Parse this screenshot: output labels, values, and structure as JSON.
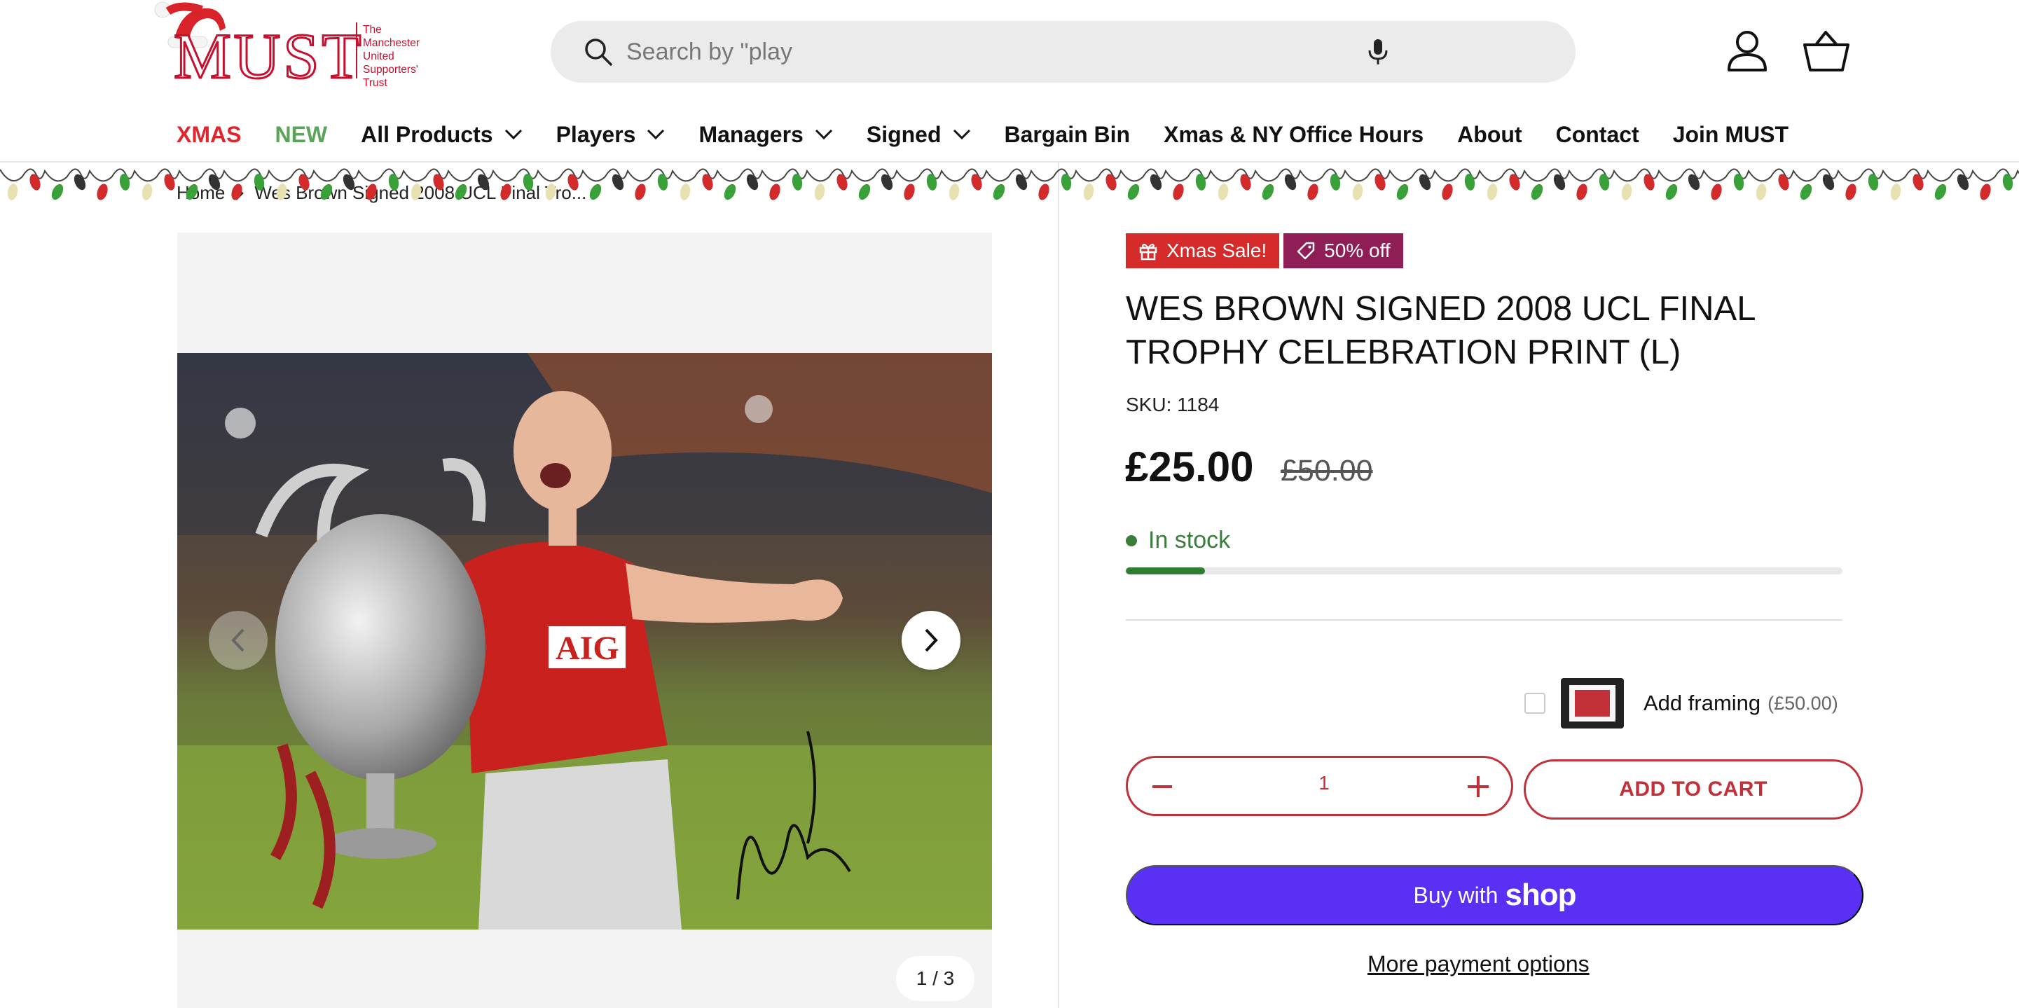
{
  "header": {
    "logo": {
      "text": "MUST",
      "tagline": [
        "The",
        "Manchester",
        "United",
        "Supporters'",
        "Trust"
      ]
    },
    "search": {
      "placeholder": "Search by \"play"
    },
    "icons": [
      "search-icon",
      "microphone-icon",
      "account-icon",
      "cart-icon",
      "santa-hat-icon"
    ]
  },
  "nav": {
    "xmas": "XMAS",
    "new": "NEW",
    "all_products": "All Products",
    "players": "Players",
    "managers": "Managers",
    "signed": "Signed",
    "bargain_bin": "Bargain Bin",
    "office_hours": "Xmas & NY Office Hours",
    "about": "About",
    "contact": "Contact",
    "join": "Join MUST"
  },
  "breadcrumb": {
    "home": "Home",
    "current": "Wes Brown Signed 2008 UCL Final Tro..."
  },
  "gallery": {
    "counter": "1 / 3"
  },
  "product": {
    "badges": {
      "sale": "Xmas Sale!",
      "discount": "50% off"
    },
    "title": "WES BROWN SIGNED 2008 UCL FINAL TROPHY CELEBRATION PRINT (L)",
    "sku": "SKU: 1184",
    "price": "£25.00",
    "compare_price": "£50.00",
    "stock": {
      "label": "In stock",
      "level": 0.11
    },
    "framing": {
      "label": "Add framing",
      "price": "(£50.00)",
      "checked": false
    },
    "quantity": "1",
    "add_to_cart": "ADD TO CART",
    "buy_with": "Buy with",
    "shop_brand": "shop",
    "more_payment": "More payment options"
  },
  "colors": {
    "brand_red": "#c2313a",
    "xmas_red": "#e0262d",
    "new_green": "#5aa55a",
    "stock_green": "#2e7d32",
    "shop_pay": "#5a31f4",
    "badge_sale": "#d62b2b",
    "badge_discount": "#8e1e55"
  }
}
